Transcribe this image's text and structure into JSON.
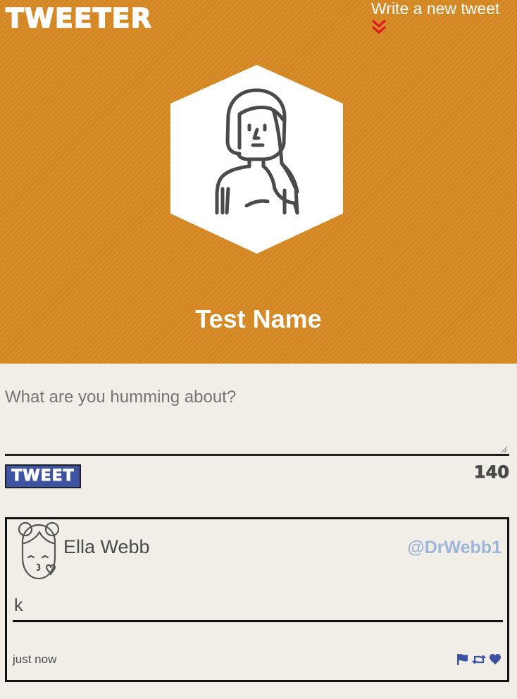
{
  "header": {
    "brand": "Tweeter",
    "compose_link": "Write a new tweet",
    "profile_name": "Test Name"
  },
  "composer": {
    "placeholder": "What are you humming about?",
    "value": "",
    "submit_label": "Tweet",
    "char_count": "140"
  },
  "tweets": [
    {
      "name": "Ella Webb",
      "handle": "@DrWebb1",
      "content": "k",
      "time": "just now",
      "actions": [
        "flag-icon",
        "retweet-icon",
        "heart-icon"
      ]
    }
  ],
  "colors": {
    "header_bg": "#d98a24",
    "page_bg": "#f1eee8",
    "accent": "#3d52a1",
    "handle": "#9db5d8",
    "chevron": "#e02020"
  }
}
